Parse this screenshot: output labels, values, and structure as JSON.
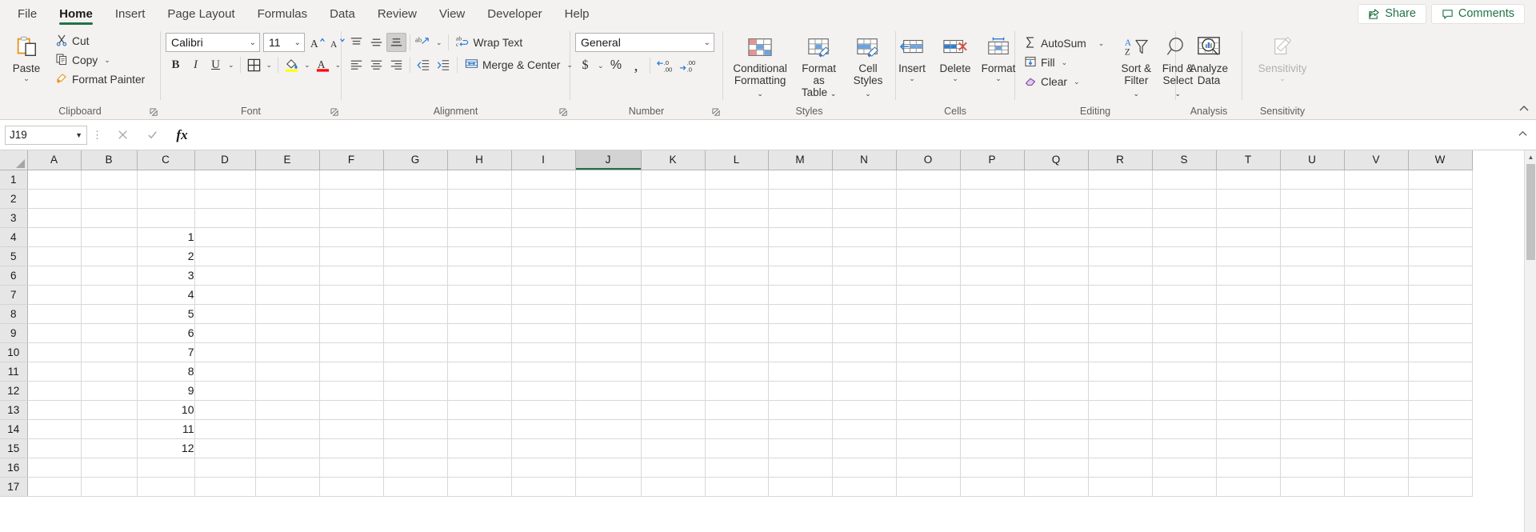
{
  "tabs": [
    {
      "label": "File",
      "active": false
    },
    {
      "label": "Home",
      "active": true
    },
    {
      "label": "Insert",
      "active": false
    },
    {
      "label": "Page Layout",
      "active": false
    },
    {
      "label": "Formulas",
      "active": false
    },
    {
      "label": "Data",
      "active": false
    },
    {
      "label": "Review",
      "active": false
    },
    {
      "label": "View",
      "active": false
    },
    {
      "label": "Developer",
      "active": false
    },
    {
      "label": "Help",
      "active": false
    }
  ],
  "titlebar": {
    "share_label": "Share",
    "comments_label": "Comments",
    "share_icon": "share-icon",
    "comments_icon": "comment-icon",
    "accent_green": "#217346"
  },
  "ribbon": {
    "groups": [
      {
        "name": "Clipboard",
        "label": "Clipboard",
        "has_launcher": true
      },
      {
        "name": "Font",
        "label": "Font",
        "has_launcher": true
      },
      {
        "name": "Alignment",
        "label": "Alignment",
        "has_launcher": true
      },
      {
        "name": "Number",
        "label": "Number",
        "has_launcher": true
      },
      {
        "name": "Styles",
        "label": "Styles",
        "has_launcher": false
      },
      {
        "name": "Cells",
        "label": "Cells",
        "has_launcher": false
      },
      {
        "name": "Editing",
        "label": "Editing",
        "has_launcher": false
      },
      {
        "name": "Analysis",
        "label": "Analysis",
        "has_launcher": false
      },
      {
        "name": "Sensitivity",
        "label": "Sensitivity",
        "has_launcher": false
      }
    ],
    "clipboard": {
      "paste_label": "Paste",
      "cut_label": "Cut",
      "copy_label": "Copy",
      "format_painter_label": "Format Painter"
    },
    "font": {
      "font_name": "Calibri",
      "font_size": "11",
      "grow_label": "A",
      "shrink_label": "A",
      "bold_label": "B",
      "italic_label": "I",
      "underline_label": "U",
      "highlight_color": "#ffff00",
      "font_color": "#ff0000"
    },
    "alignment": {
      "wrap_text_label": "Wrap Text",
      "merge_center_label": "Merge & Center"
    },
    "number": {
      "format_value": "General",
      "currency_label": "$",
      "percent_label": "%",
      "comma_label": ",",
      "increase_decimal_label": ".00",
      "decrease_decimal_label": ".00"
    },
    "styles": {
      "conditional_formatting_label": "Conditional\nFormatting",
      "conditional_formatting_line1": "Conditional",
      "conditional_formatting_line2": "Formatting",
      "format_as_table_line1": "Format as",
      "format_as_table_line2": "Table",
      "cell_styles_line1": "Cell",
      "cell_styles_line2": "Styles"
    },
    "cells": {
      "insert_label": "Insert",
      "delete_label": "Delete",
      "format_label": "Format"
    },
    "editing": {
      "autosum_label": "AutoSum",
      "fill_label": "Fill",
      "clear_label": "Clear",
      "sort_filter_line1": "Sort &",
      "sort_filter_line2": "Filter",
      "find_select_line1": "Find &",
      "find_select_line2": "Select"
    },
    "analysis": {
      "analyze_data_line1": "Analyze",
      "analyze_data_line2": "Data"
    },
    "sensitivity": {
      "sensitivity_label": "Sensitivity",
      "disabled": true
    }
  },
  "formula_bar": {
    "name_box_value": "J19",
    "formula_value": "",
    "cancel_icon": "cancel-icon",
    "enter_icon": "check-icon",
    "function_icon": "fx-icon"
  },
  "grid": {
    "columns": [
      "A",
      "B",
      "C",
      "D",
      "E",
      "F",
      "G",
      "H",
      "I",
      "J",
      "K",
      "L",
      "M",
      "N",
      "O",
      "P",
      "Q",
      "R",
      "S",
      "T",
      "U",
      "V",
      "W"
    ],
    "active_column": "J",
    "active_cell": "J19",
    "rows": [
      1,
      2,
      3,
      4,
      5,
      6,
      7,
      8,
      9,
      10,
      11,
      12,
      13,
      14,
      15,
      16,
      17
    ],
    "cells": {
      "C4": "1",
      "C5": "2",
      "C6": "3",
      "C7": "4",
      "C8": "5",
      "C9": "6",
      "C10": "7",
      "C11": "8",
      "C12": "9",
      "C13": "10",
      "C14": "11",
      "C15": "12"
    }
  }
}
